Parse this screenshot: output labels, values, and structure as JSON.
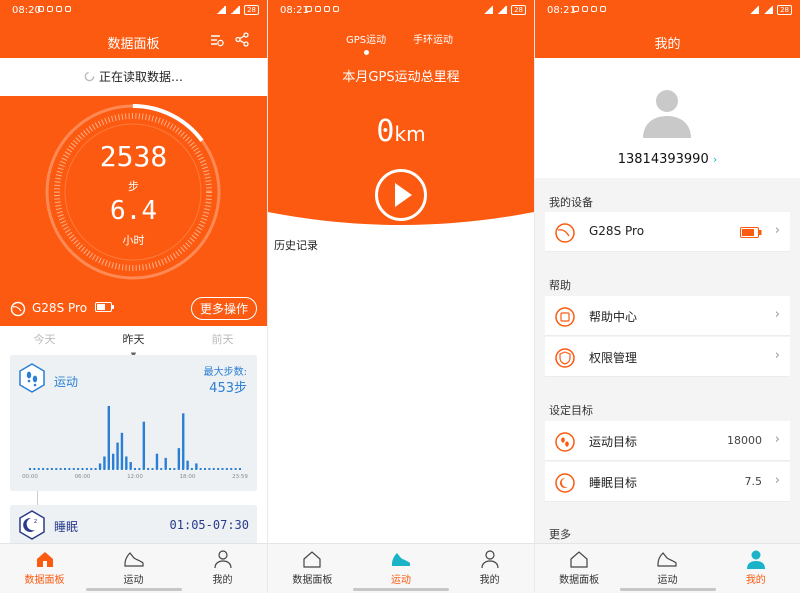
{
  "panel1": {
    "status": {
      "time": "08:20",
      "battery": "28"
    },
    "title": "数据面板",
    "loading_text": "正在读取数据…",
    "steps_value": "2538",
    "steps_unit": "步",
    "hours_value": "6.4",
    "hours_unit": "小时",
    "device_name": "G28S Pro",
    "more_button": "更多操作",
    "day_tabs": [
      "今天",
      "昨天",
      "前天"
    ],
    "selected_day": "昨天",
    "sport": {
      "title": "运动",
      "max_label": "最大步数:",
      "max_value": "453步",
      "x_ticks": [
        "00:00",
        "06:00",
        "12:00",
        "18:00",
        "23:59"
      ],
      "chart_data": {
        "type": "bar",
        "x": [
          "08:00",
          "08:30",
          "09:00",
          "09:30",
          "10:00",
          "10:30",
          "11:00",
          "11:30",
          "13:00",
          "14:30",
          "15:30",
          "17:00",
          "17:30",
          "18:00",
          "19:00"
        ],
        "values": [
          40,
          90,
          453,
          110,
          190,
          260,
          90,
          50,
          340,
          110,
          80,
          150,
          400,
          60,
          40
        ],
        "ylim": [
          0,
          460
        ]
      }
    },
    "sleep": {
      "title": "睡眠",
      "range": "01:05-07:30"
    },
    "nav": [
      "数据面板",
      "运动",
      "我的"
    ]
  },
  "panel2": {
    "status": {
      "time": "08:21",
      "battery": "28"
    },
    "tabs": [
      "GPS运动",
      "手环运动"
    ],
    "headline": "本月GPS运动总里程",
    "distance_value": "0",
    "distance_unit": "km",
    "history_label": "历史记录",
    "nav": [
      "数据面板",
      "运动",
      "我的"
    ]
  },
  "panel3": {
    "status": {
      "time": "08:21",
      "battery": "28"
    },
    "title": "我的",
    "phone": "13814393990",
    "sections": {
      "devices": "我的设备",
      "help": "帮助",
      "goals": "设定目标",
      "more": "更多"
    },
    "device_row": {
      "label": "G28S Pro"
    },
    "help_rows": [
      {
        "label": "帮助中心"
      },
      {
        "label": "权限管理"
      }
    ],
    "goal_rows": [
      {
        "label": "运动目标",
        "value": "18000"
      },
      {
        "label": "睡眠目标",
        "value": "7.5"
      }
    ],
    "nav": [
      "数据面板",
      "运动",
      "我的"
    ]
  },
  "colors": {
    "accent": "#fb5a10",
    "sport_blue": "#2a7fd5",
    "active_cyan": "#1ab3c8"
  }
}
